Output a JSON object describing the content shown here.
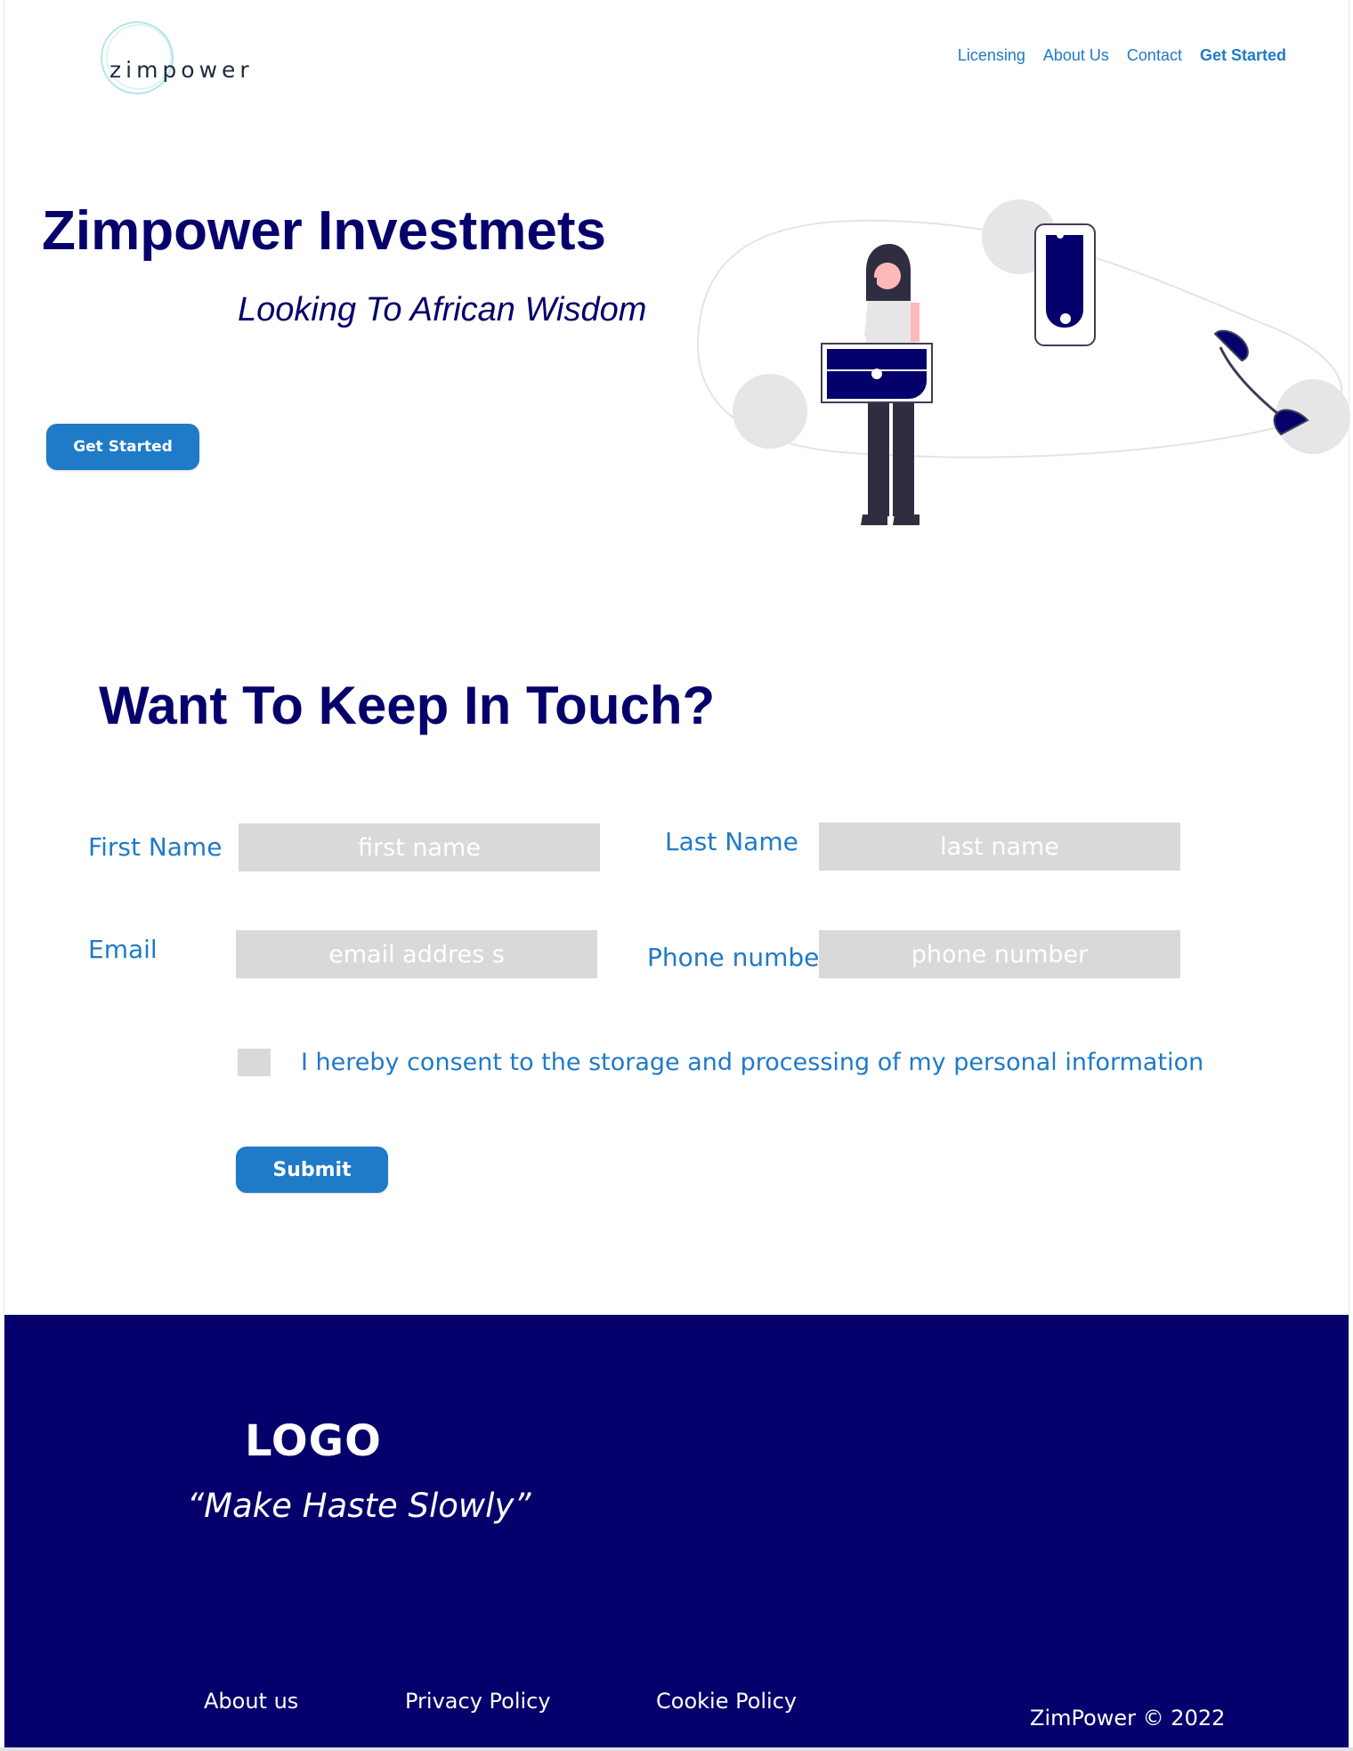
{
  "header": {
    "logo_text": "zimpower",
    "nav": [
      {
        "label": "Licensing"
      },
      {
        "label": "About Us"
      },
      {
        "label": "Contact"
      },
      {
        "label": "Get Started"
      }
    ]
  },
  "hero": {
    "title": "Zimpower Investmets",
    "subtitle": "Looking To African Wisdom",
    "cta_label": "Get Started"
  },
  "contact": {
    "title": "Want To Keep In Touch?",
    "first_name_label": "First Name",
    "first_name_placeholder": "first name",
    "last_name_label": "Last Name",
    "last_name_placeholder": "last name",
    "email_label": "Email",
    "email_placeholder": "email addres s",
    "phone_label": "Phone number",
    "phone_placeholder": "phone number",
    "consent_label": "I hereby consent to the storage and processing of my personal information",
    "submit_label": "Submit"
  },
  "footer": {
    "logo": "LOGO",
    "tagline": "“Make Haste Slowly”",
    "links": [
      {
        "label": "About us"
      },
      {
        "label": "Privacy Policy"
      },
      {
        "label": "Cookie Policy"
      }
    ],
    "copyright": "ZimPower © 2022"
  },
  "colors": {
    "navy": "#05006b",
    "accent_blue": "#1f7ac7",
    "field_gray": "#d9d9d9"
  }
}
